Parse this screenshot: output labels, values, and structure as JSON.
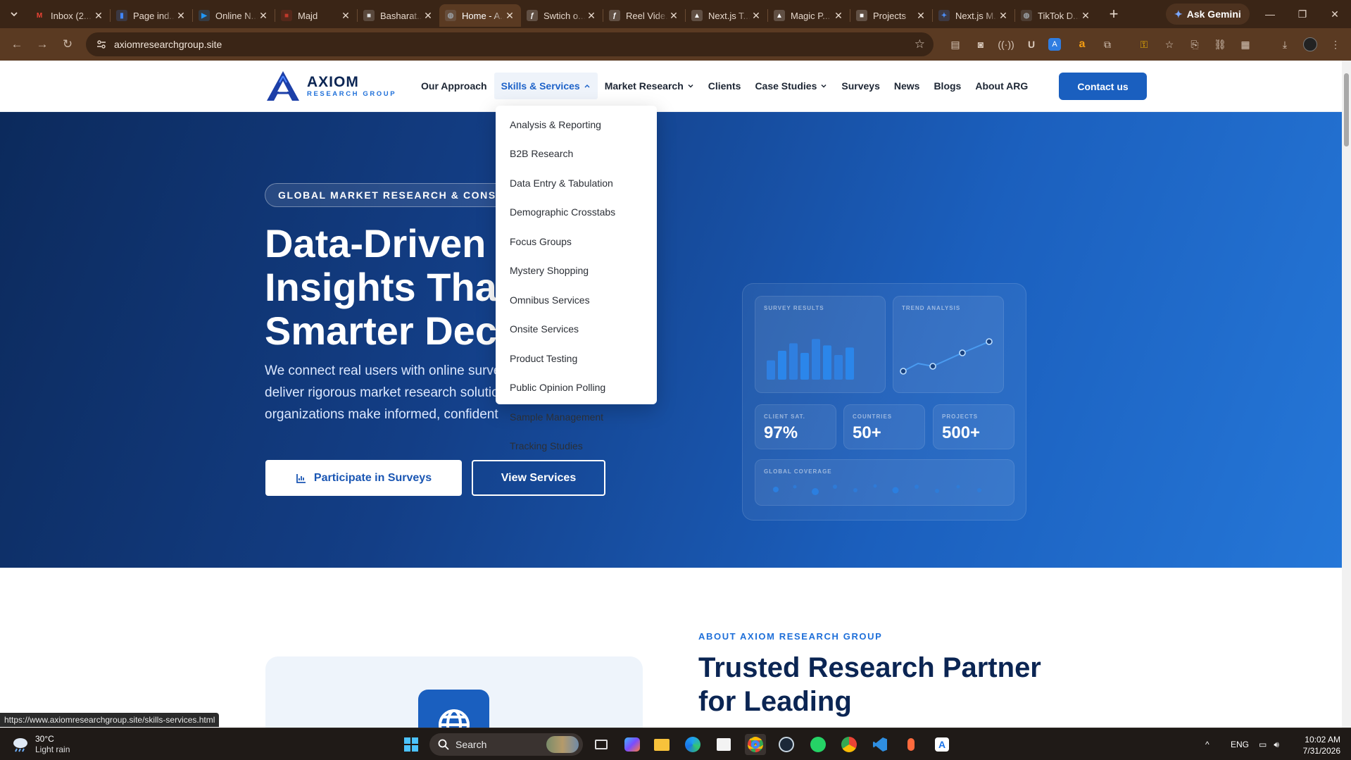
{
  "browser": {
    "tabs": [
      {
        "title": "Inbox (2...",
        "icon": "gmail-icon",
        "color": "#ea4335"
      },
      {
        "title": "Page ind...",
        "icon": "search-console-icon",
        "color": "#4285f4"
      },
      {
        "title": "Online N...",
        "icon": "play-icon",
        "color": "#2196f3"
      },
      {
        "title": "Majd",
        "icon": "profile-icon",
        "color": "#c0392b"
      },
      {
        "title": "Basharat...",
        "icon": "page-icon",
        "color": "#dddddd"
      },
      {
        "title": "Home - A...",
        "icon": "globe-icon",
        "color": "#9aa0a6",
        "active": true
      },
      {
        "title": "Swtich o...",
        "icon": "framer-icon",
        "color": "#ffffff"
      },
      {
        "title": "Reel Vide...",
        "icon": "framer-icon",
        "color": "#ffffff"
      },
      {
        "title": "Next.js T...",
        "icon": "vercel-icon",
        "color": "#ffffff"
      },
      {
        "title": "Magic P...",
        "icon": "vercel-icon",
        "color": "#ffffff"
      },
      {
        "title": "Projects",
        "icon": "project-icon",
        "color": "#ffffff"
      },
      {
        "title": "Next.js M...",
        "icon": "sparkle-icon",
        "color": "#4c8df6"
      },
      {
        "title": "TikTok D...",
        "icon": "globe-icon",
        "color": "#9aa0a6"
      }
    ],
    "ask_gemini": "Ask Gemini",
    "url": "axiomresearchgroup.site"
  },
  "site": {
    "logo_name": "AXIOM",
    "logo_sub": "RESEARCH GROUP",
    "nav": [
      {
        "label": "Our Approach",
        "dropdown": false
      },
      {
        "label": "Skills & Services",
        "dropdown": true,
        "open": true
      },
      {
        "label": "Market Research",
        "dropdown": true
      },
      {
        "label": "Clients",
        "dropdown": false
      },
      {
        "label": "Case Studies",
        "dropdown": true
      },
      {
        "label": "Surveys",
        "dropdown": false
      },
      {
        "label": "News",
        "dropdown": false
      },
      {
        "label": "Blogs",
        "dropdown": false
      },
      {
        "label": "About ARG",
        "dropdown": false
      }
    ],
    "contact_label": "Contact us",
    "services_menu": [
      "Analysis & Reporting",
      "B2B Research",
      "Data Entry & Tabulation",
      "Demographic Crosstabs",
      "Focus Groups",
      "Mystery Shopping",
      "Omnibus Services",
      "Onsite Services",
      "Product Testing",
      "Public Opinion Polling",
      "Sample Management",
      "Tracking Studies"
    ],
    "hero": {
      "eyebrow": "GLOBAL MARKET RESEARCH & CONSULT",
      "headline_lines": [
        "Data-Driven",
        "Insights Tha",
        "Smarter Dec"
      ],
      "lead_lines": [
        "We connect real users with online surve",
        "deliver rigorous market research solutio",
        "organizations make informed, confident"
      ],
      "btn_participate": "Participate in Surveys",
      "btn_view": "View Services"
    },
    "dashboard": {
      "survey_label": "SURVEY RESULTS",
      "trend_label": "TREND ANALYSIS",
      "stats": [
        {
          "label": "CLIENT SAT.",
          "value": "97%"
        },
        {
          "label": "COUNTRIES",
          "value": "50+"
        },
        {
          "label": "PROJECTS",
          "value": "500+"
        }
      ],
      "coverage_label": "GLOBAL COVERAGE",
      "bar_values": [
        0.36,
        0.54,
        0.68,
        0.5,
        0.76,
        0.64,
        0.46,
        0.6
      ]
    },
    "about": {
      "eyebrow": "ABOUT AXIOM RESEARCH GROUP",
      "heading_lines": [
        "Trusted Research Partner",
        "for Leading"
      ]
    }
  },
  "status_url": "https://www.axiomresearchgroup.site/skills-services.html",
  "taskbar": {
    "weather_temp": "30°C",
    "weather_desc": "Light rain",
    "search_label": "Search",
    "lang": "ENG",
    "time": "10:02 AM",
    "date": "7/31/2026"
  }
}
